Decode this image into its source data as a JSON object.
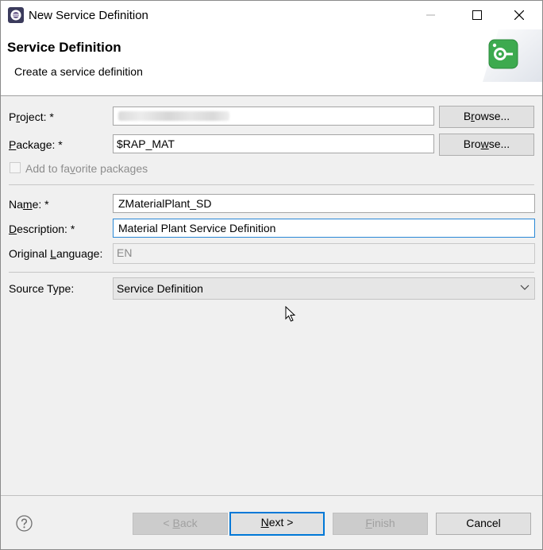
{
  "window": {
    "title": "New Service Definition",
    "controls": {
      "minimize": "minimize",
      "maximize": "maximize",
      "close": "close"
    }
  },
  "header": {
    "title": "Service Definition",
    "subtitle": "Create a service definition",
    "icon": "service-definition-wizard-icon"
  },
  "form": {
    "project": {
      "label_pre": "P",
      "label_mn": "r",
      "label_post": "oject: *",
      "value": "",
      "browse": {
        "pre": "B",
        "mn": "r",
        "post": "owse..."
      }
    },
    "package": {
      "label_pre": "",
      "label_mn": "P",
      "label_post": "ackage: *",
      "value": "$RAP_MAT",
      "browse": {
        "pre": "Bro",
        "mn": "w",
        "post": "se..."
      }
    },
    "favorite": {
      "label_pre": "Add to fa",
      "label_mn": "v",
      "label_post": "orite packages",
      "checked": false,
      "enabled": false
    },
    "name": {
      "label_pre": "Na",
      "label_mn": "m",
      "label_post": "e: *",
      "value": "ZMaterialPlant_SD"
    },
    "description": {
      "label_pre": "",
      "label_mn": "D",
      "label_post": "escription: *",
      "value": "Material Plant Service Definition"
    },
    "language": {
      "label_pre": "Original ",
      "label_mn": "L",
      "label_post": "anguage:",
      "value": "EN"
    },
    "source_type": {
      "label": "Source Type:",
      "value": "Service Definition"
    }
  },
  "footer": {
    "help_icon": "help-icon",
    "back": {
      "pre": "< ",
      "mn": "B",
      "post": "ack"
    },
    "next": {
      "pre": "",
      "mn": "N",
      "post": "ext >"
    },
    "finish": {
      "pre": "",
      "mn": "F",
      "post": "inish"
    },
    "cancel": "Cancel"
  },
  "colors": {
    "accent": "#0078d7",
    "focus_border": "#2a88d6",
    "icon_green": "#3daa4f"
  }
}
